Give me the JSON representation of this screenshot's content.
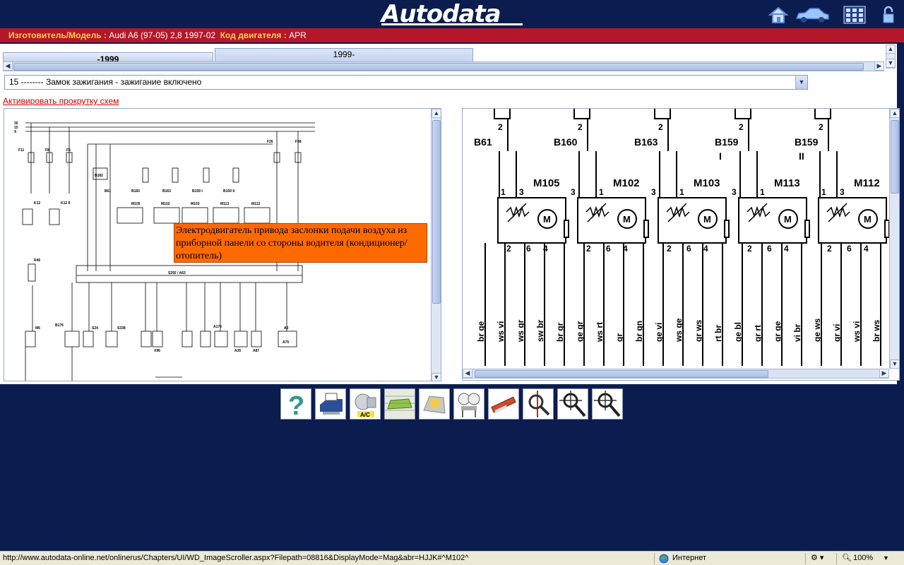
{
  "header": {
    "logo_text": "Autodata",
    "model_label": "Изготовитель/Модель :",
    "model_value": "Audi A6 (97-05) 2,8 1997-02",
    "engine_label": "Код двигателя :",
    "engine_value": "APR"
  },
  "tabs": [
    {
      "label": "-1999"
    },
    {
      "label": "1999-"
    }
  ],
  "circuit_select": {
    "value": "15 -------- Замок зажигания - зажигание включено"
  },
  "scroll_link": "Активировать прокрутку схем",
  "tooltip": "Электродвигатель привода заслонки подачи воздуха из приборной панели со стороны водителя (кондиционер/отопитель)",
  "left_diagram": {
    "rails": [
      "30",
      "15",
      "X"
    ],
    "labels": [
      "F11",
      "F8",
      "F5",
      "F26",
      "F38",
      "B182",
      "B61",
      "B160",
      "B163",
      "B159 I",
      "B159 II",
      "M105",
      "M102",
      "M103",
      "M113",
      "M112",
      "K12",
      "K12 II",
      "R46",
      "S292 / A63",
      "M6",
      "B176",
      "S24",
      "S338",
      "X96",
      "A176",
      "A35",
      "A87",
      "A3",
      "A75"
    ]
  },
  "right_diagram": {
    "sensors": [
      "B61",
      "B160",
      "B163",
      "B159 I",
      "B159 II"
    ],
    "motors": [
      {
        "name": "M105",
        "top_pins": [
          "1",
          "3"
        ],
        "bottom_pins": [
          "2",
          "6",
          "4"
        ]
      },
      {
        "name": "M102",
        "top_pins": [
          "3",
          "1"
        ],
        "bottom_pins": [
          "2",
          "6",
          "4"
        ]
      },
      {
        "name": "M103",
        "top_pins": [
          "3",
          "1"
        ],
        "bottom_pins": [
          "2",
          "6",
          "4"
        ]
      },
      {
        "name": "M113",
        "top_pins": [
          "3",
          "1"
        ],
        "bottom_pins": [
          "2",
          "6",
          "4"
        ]
      },
      {
        "name": "M112",
        "top_pins": [
          "1",
          "3"
        ],
        "bottom_pins": [
          "2",
          "6",
          "4"
        ]
      }
    ],
    "top_pins": [
      "2",
      "2",
      "2",
      "2",
      "2"
    ],
    "wire_colors": [
      "br ge",
      "ws vi",
      "ws gr",
      "sw br",
      "br gr",
      "ge gr",
      "ws rt",
      "gr",
      "br gn",
      "ge vi",
      "ws ge",
      "gr ws",
      "rt br",
      "ge bl",
      "gr rt",
      "gr ge",
      "vi br",
      "ge ws",
      "gr vi",
      "ws vi",
      "br ws"
    ]
  },
  "toolbar": {
    "items": [
      "help-icon",
      "print-icon",
      "ac-compressor-icon",
      "car-layout-icon",
      "component-location-icon",
      "gauge-icon",
      "tool-icon",
      "magnifier-red-icon",
      "zoom-in-icon",
      "zoom-out-icon"
    ],
    "ac_badge": "A/C"
  },
  "status": {
    "url": "http://www.autodata-online.net/onlinerus/Chapters/UI/WD_ImageScroller.aspx?Filepath=08816&DisplayMode=Mag&abr=HJJK#^M102^",
    "zone": "Интернет",
    "zoom": "100%"
  }
}
